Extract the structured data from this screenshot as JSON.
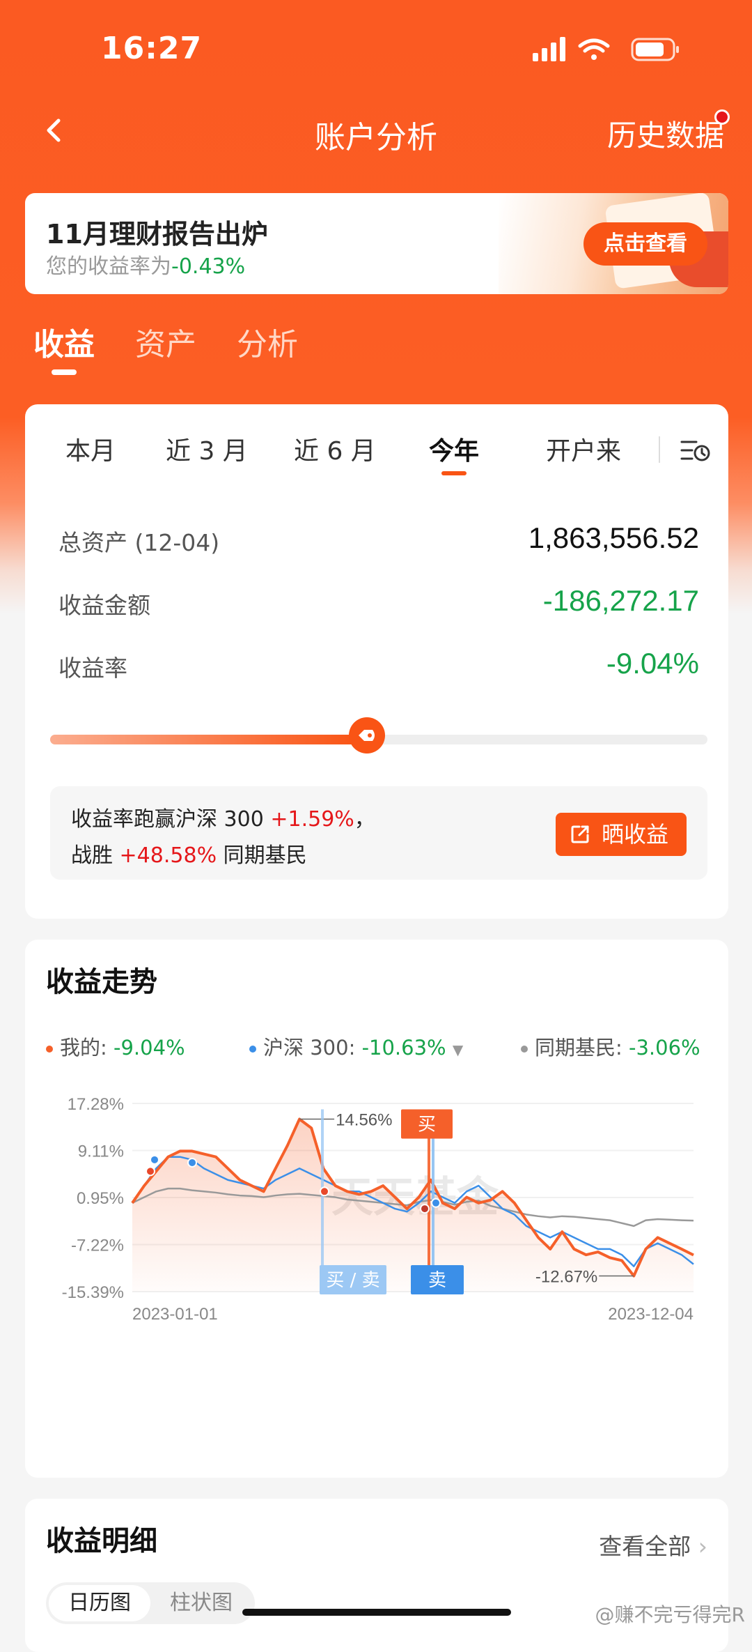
{
  "status_bar": {
    "time": "16:27"
  },
  "nav": {
    "title": "账户分析",
    "right_link": "历史数据"
  },
  "banner": {
    "title": "11月理财报告出炉",
    "subtitle_prefix": "您的收益率为",
    "subtitle_value": "-0.43%",
    "button": "点击查看"
  },
  "top_tabs": [
    {
      "label": "收益",
      "active": true
    },
    {
      "label": "资产",
      "active": false
    },
    {
      "label": "分析",
      "active": false
    }
  ],
  "periods": [
    {
      "label": "本月"
    },
    {
      "label": "近 3 月"
    },
    {
      "label": "近 6 月"
    },
    {
      "label": "今年",
      "active": true
    },
    {
      "label": "开户来"
    }
  ],
  "summary": {
    "total_assets_label": "总资产 (12-04)",
    "total_assets_value": "1,863,556.52",
    "profit_label": "收益金额",
    "profit_value": "-186,272.17",
    "rate_label": "收益率",
    "rate_value": "-9.04%",
    "beat_percentile": 0.465
  },
  "comparison": {
    "line1_prefix": "收益率跑赢沪深 300",
    "line1_value": "+1.59%",
    "line1_suffix": "，",
    "line2_prefix": "战胜",
    "line2_value": "+48.58%",
    "line2_suffix": "同期基民",
    "button": "晒收益"
  },
  "trend": {
    "title": "收益走势",
    "legend": [
      {
        "label": "我的: ",
        "value": "-9.04%",
        "color": "#f5602a"
      },
      {
        "label": "沪深 300: ",
        "value": "-10.63%",
        "color": "#3b8fe8"
      },
      {
        "label": "同期基民: ",
        "value": "-3.06%",
        "color": "#999999"
      }
    ],
    "watermark": "天天基金"
  },
  "chart_data": {
    "type": "line",
    "y_ticks": [
      "17.28%",
      "9.11%",
      "0.95%",
      "-7.22%",
      "-15.39%"
    ],
    "ylim": [
      -15.39,
      17.28
    ],
    "x_ticks": [
      "2023-01-01",
      "2023-12-04"
    ],
    "series": [
      {
        "name": "我的",
        "color": "#f5602a",
        "values": [
          0,
          3,
          5.5,
          8,
          9,
          9,
          8.5,
          8,
          6,
          4,
          3,
          2,
          6,
          10,
          14.56,
          13,
          6,
          3,
          2,
          1.5,
          2,
          3,
          1,
          -1,
          1,
          4,
          0,
          -1,
          1,
          0,
          0.5,
          2,
          0,
          -3,
          -6,
          -8,
          -5,
          -8,
          -9,
          -8.5,
          -9.5,
          -10,
          -12.67,
          -8,
          -6,
          -7,
          -8,
          -9.04
        ]
      },
      {
        "name": "沪深 300",
        "color": "#3b8fe8",
        "values": [
          0,
          3,
          6,
          8,
          8,
          7.5,
          6,
          5,
          4,
          3.5,
          3,
          2.5,
          4,
          5,
          6,
          5,
          4,
          3,
          2,
          2,
          1,
          0,
          -1,
          -1.5,
          0,
          2,
          1,
          0,
          2,
          3,
          1,
          -1,
          -2,
          -4,
          -5,
          -6,
          -5,
          -6,
          -7,
          -8,
          -8,
          -9,
          -11,
          -8,
          -7,
          -8,
          -9,
          -10.63
        ]
      },
      {
        "name": "同期基民",
        "color": "#999999",
        "values": [
          0,
          1,
          2,
          2.5,
          2.5,
          2.2,
          2,
          1.8,
          1.5,
          1.3,
          1.2,
          1,
          1.3,
          1.5,
          1.6,
          1.4,
          1.2,
          1,
          0.6,
          0.4,
          0.2,
          0,
          -0.2,
          -0.4,
          0.2,
          0.5,
          0.2,
          -0.3,
          0.2,
          0.4,
          -0.5,
          -1,
          -1.5,
          -2,
          -2.3,
          -2.5,
          -2.3,
          -2.4,
          -2.6,
          -2.8,
          -3,
          -3.5,
          -4,
          -3,
          -2.8,
          -2.9,
          -3,
          -3.06
        ]
      }
    ],
    "annotations": [
      {
        "text": "14.56%",
        "type": "max"
      },
      {
        "text": "-12.67%",
        "type": "min"
      },
      {
        "text": "买",
        "type": "buy-tag"
      },
      {
        "text": "买 / 卖",
        "type": "buysell-tag"
      },
      {
        "text": "卖",
        "type": "sell-tag"
      }
    ]
  },
  "detail": {
    "title": "收益明细",
    "view_all": "查看全部",
    "view_all_arrow": "›",
    "tab_calendar": "日历图",
    "tab_bar": "柱状图"
  },
  "footer_watermark": "@赚不完亏得完R"
}
